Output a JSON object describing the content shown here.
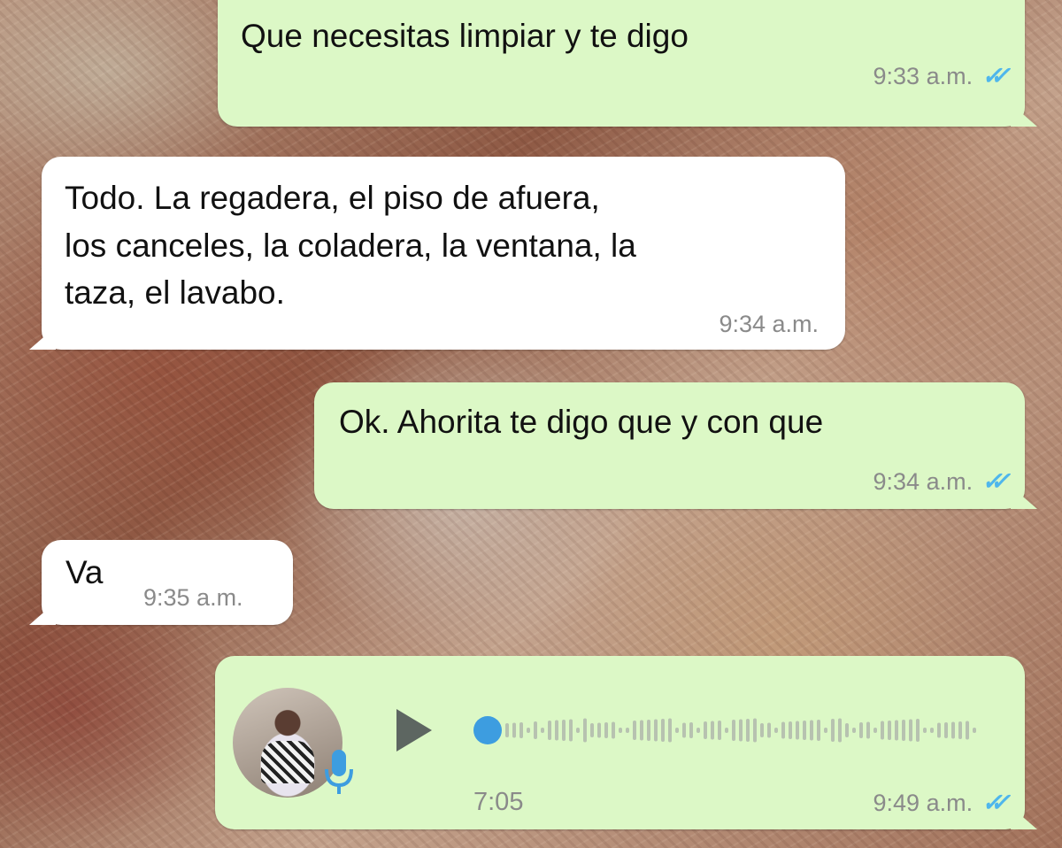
{
  "messages": [
    {
      "id": "m1",
      "direction": "outgoing",
      "text": "Que necesitas limpiar y te digo",
      "time": "9:33 a.m.",
      "ticks": "✓✓"
    },
    {
      "id": "m2",
      "direction": "incoming",
      "text": "Todo.  La regadera, el piso de afuera,\nlos canceles, la coladera, la ventana, la\ntaza, el lavabo.",
      "time": "9:34 a.m."
    },
    {
      "id": "m3",
      "direction": "outgoing",
      "text": "Ok. Ahorita te digo que y con que",
      "time": "9:34 a.m.",
      "ticks": "✓✓"
    },
    {
      "id": "m4",
      "direction": "incoming",
      "text": "Va",
      "time": "9:35 a.m."
    }
  ],
  "voice_note": {
    "direction": "outgoing",
    "duration": "7:05",
    "time": "9:49 a.m.",
    "ticks": "✓✓",
    "progress": 0,
    "icons": {
      "play": "play-icon",
      "mic": "microphone-icon",
      "avatar": "sender-avatar"
    },
    "colors": {
      "played_dot": "#3d9de0",
      "waveform": "#b7c2b0",
      "play": "#5d6661"
    }
  },
  "colors": {
    "outgoing_bubble": "#dcf8c6",
    "incoming_bubble": "#ffffff",
    "read_ticks": "#4fb6ec",
    "meta_text": "#8a8a8a"
  }
}
